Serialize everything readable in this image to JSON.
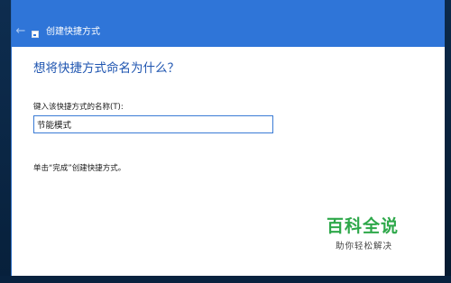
{
  "window": {
    "title": "创建快捷方式",
    "back_glyph": "←",
    "back_icon": "back-arrow-icon",
    "app_icon": "shortcut-icon"
  },
  "main": {
    "heading": "想将快捷方式命名为什么？",
    "field_label": "键入该快捷方式的名称(T):",
    "name_value": "节能模式",
    "hint": "单击“完成”创建快捷方式。"
  },
  "watermark": {
    "brand": "百科全说",
    "tagline": "助你轻松解决"
  },
  "colors": {
    "titlebar": "#2f75d8",
    "heading": "#1f55b0",
    "input_border": "#3a7bd5",
    "watermark_brand": "#2ea84a"
  }
}
